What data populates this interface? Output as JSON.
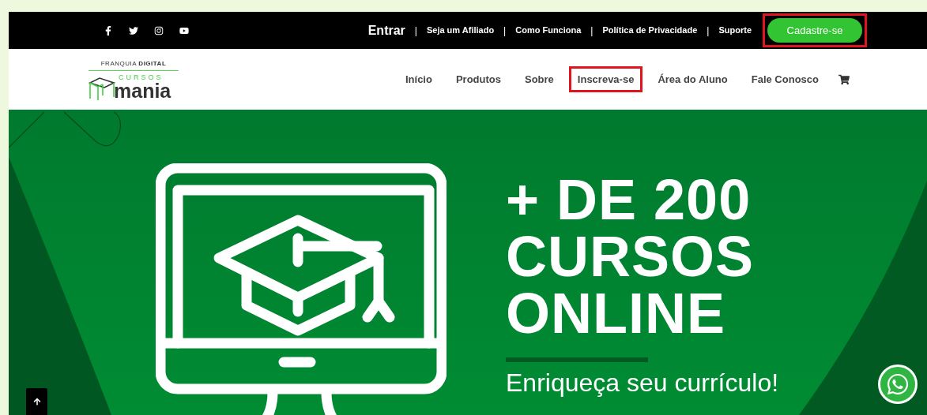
{
  "top_bar": {
    "links": [
      {
        "label": "Entrar",
        "kind": "login"
      },
      {
        "label": "Seja um Afiliado",
        "kind": "link"
      },
      {
        "label": "Como Funciona",
        "kind": "link"
      },
      {
        "label": "Política de Privacidade",
        "kind": "link"
      },
      {
        "label": "Suporte",
        "kind": "link"
      }
    ],
    "separator": "|",
    "signup_button": {
      "label": "Cadastre-se",
      "highlighted": true
    }
  },
  "logo": {
    "tagline": "FRANQUIA **DIGITAL**",
    "word_top": "CURSOS",
    "word_main": "mania"
  },
  "nav": [
    {
      "label": "Início",
      "highlighted": false
    },
    {
      "label": "Produtos",
      "highlighted": false
    },
    {
      "label": "Sobre",
      "highlighted": false
    },
    {
      "label": "Inscreva-se",
      "highlighted": true
    },
    {
      "label": "Área do Aluno",
      "highlighted": false
    },
    {
      "label": "Fale Conosco",
      "highlighted": false
    }
  ],
  "hero": {
    "heading": [
      "+ DE 200",
      "CURSOS",
      "ONLINE"
    ],
    "subtitle": "Enriqueça seu currículo!"
  }
}
